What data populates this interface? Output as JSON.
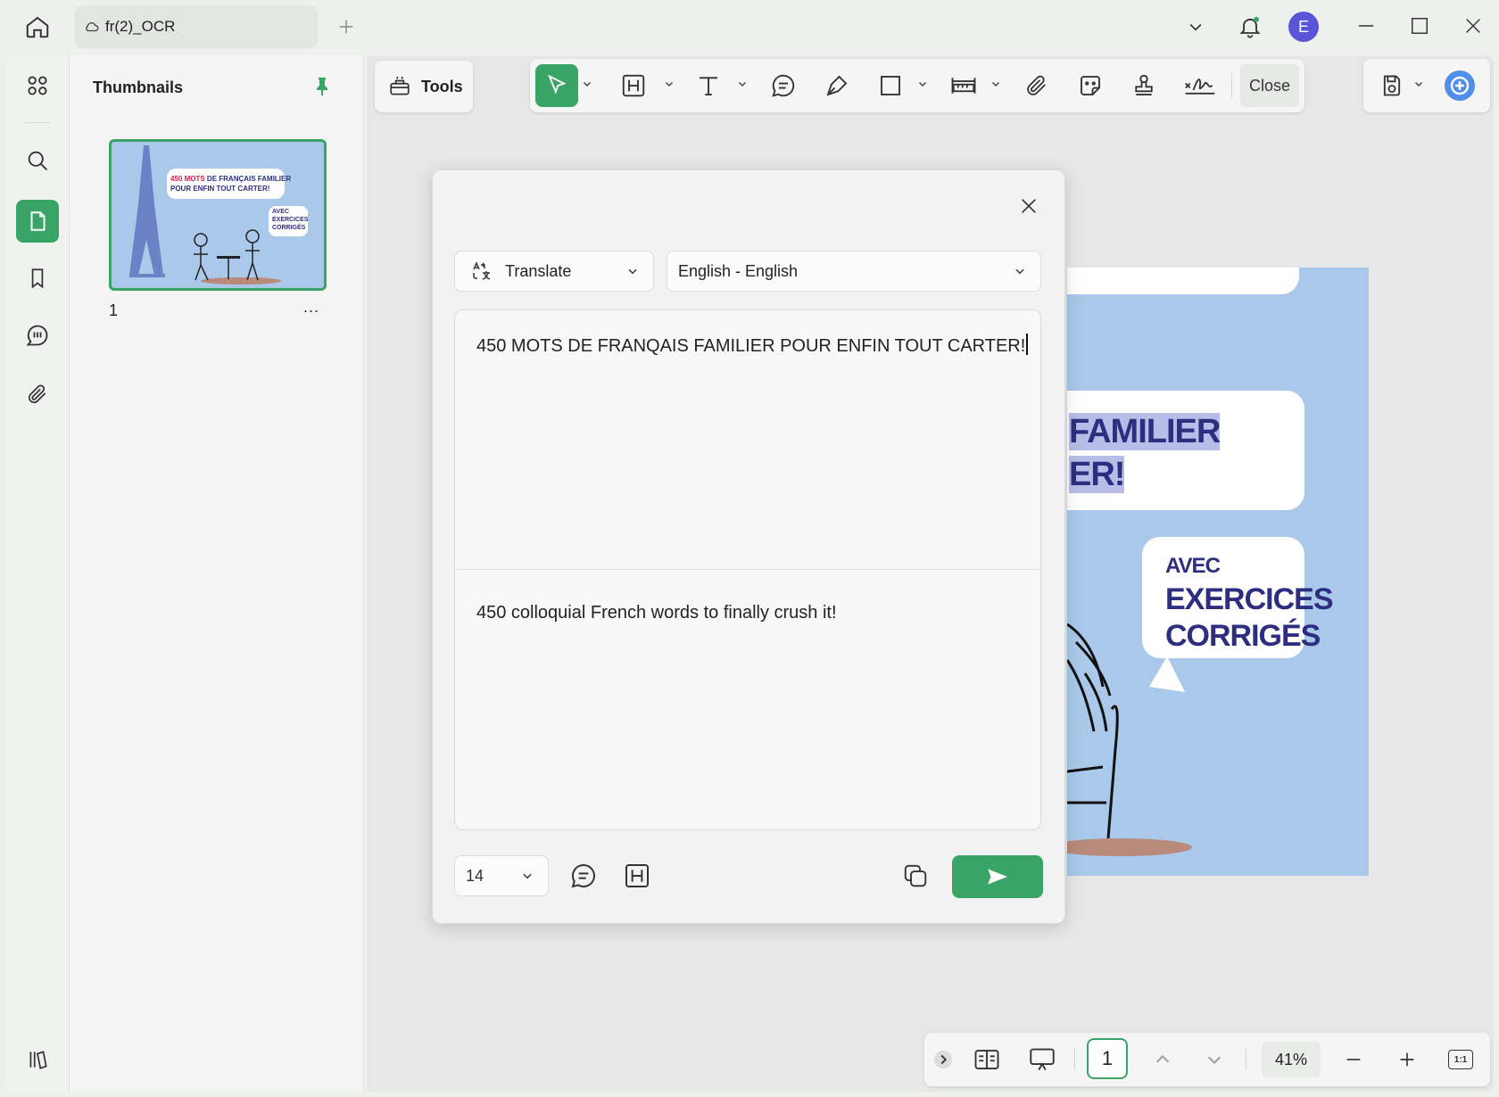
{
  "titlebar": {
    "tab_title": "fr(2)_OCR",
    "avatar_letter": "E"
  },
  "thumbnails": {
    "title": "Thumbnails",
    "page_number": "1",
    "more": "..."
  },
  "toolbar": {
    "tools_label": "Tools",
    "close_label": "Close"
  },
  "page_art": {
    "bubble1_line1": "FAMILIER",
    "bubble1_line2": "ER!",
    "bubble2_line1": "AVEC",
    "bubble2_line2": "EXERCICES",
    "bubble2_line3": "CORRIGÉS"
  },
  "thumb_art": {
    "line1_red": "450 MOTS",
    "line1_rest": " DE FRANÇAIS FAMILIER",
    "line2": "POUR ENFIN TOUT CARTER!",
    "small1": "AVEC",
    "small2": "EXERCICES",
    "small3": "CORRIGÉS"
  },
  "dialog": {
    "mode_label": "Translate",
    "language_label": "English - English",
    "source_text": "450 MOTS DE FRANQAIS FAMILIER POUR ENFIN TOUT CARTER!",
    "translated_text": "450 colloquial French words to finally crush it!",
    "font_size": "14"
  },
  "bottombar": {
    "page_number": "1",
    "zoom": "41%",
    "actual_size": "1:1"
  },
  "colors": {
    "accent": "#3aa466",
    "avatar": "#5a55d8",
    "page_background": "#a9c8ea",
    "page_text": "#2e2e80"
  }
}
